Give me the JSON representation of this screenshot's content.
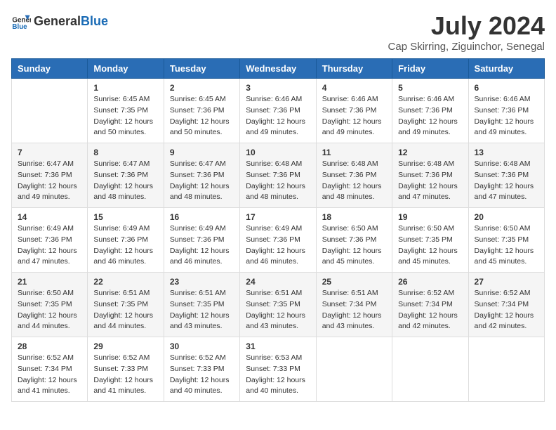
{
  "logo": {
    "text_general": "General",
    "text_blue": "Blue"
  },
  "title": "July 2024",
  "subtitle": "Cap Skirring, Ziguinchor, Senegal",
  "weekdays": [
    "Sunday",
    "Monday",
    "Tuesday",
    "Wednesday",
    "Thursday",
    "Friday",
    "Saturday"
  ],
  "weeks": [
    [
      {
        "day": "",
        "info": ""
      },
      {
        "day": "1",
        "info": "Sunrise: 6:45 AM\nSunset: 7:35 PM\nDaylight: 12 hours and 50 minutes."
      },
      {
        "day": "2",
        "info": "Sunrise: 6:45 AM\nSunset: 7:36 PM\nDaylight: 12 hours and 50 minutes."
      },
      {
        "day": "3",
        "info": "Sunrise: 6:46 AM\nSunset: 7:36 PM\nDaylight: 12 hours and 49 minutes."
      },
      {
        "day": "4",
        "info": "Sunrise: 6:46 AM\nSunset: 7:36 PM\nDaylight: 12 hours and 49 minutes."
      },
      {
        "day": "5",
        "info": "Sunrise: 6:46 AM\nSunset: 7:36 PM\nDaylight: 12 hours and 49 minutes."
      },
      {
        "day": "6",
        "info": "Sunrise: 6:46 AM\nSunset: 7:36 PM\nDaylight: 12 hours and 49 minutes."
      }
    ],
    [
      {
        "day": "7",
        "info": "Sunrise: 6:47 AM\nSunset: 7:36 PM\nDaylight: 12 hours and 49 minutes."
      },
      {
        "day": "8",
        "info": "Sunrise: 6:47 AM\nSunset: 7:36 PM\nDaylight: 12 hours and 48 minutes."
      },
      {
        "day": "9",
        "info": "Sunrise: 6:47 AM\nSunset: 7:36 PM\nDaylight: 12 hours and 48 minutes."
      },
      {
        "day": "10",
        "info": "Sunrise: 6:48 AM\nSunset: 7:36 PM\nDaylight: 12 hours and 48 minutes."
      },
      {
        "day": "11",
        "info": "Sunrise: 6:48 AM\nSunset: 7:36 PM\nDaylight: 12 hours and 48 minutes."
      },
      {
        "day": "12",
        "info": "Sunrise: 6:48 AM\nSunset: 7:36 PM\nDaylight: 12 hours and 47 minutes."
      },
      {
        "day": "13",
        "info": "Sunrise: 6:48 AM\nSunset: 7:36 PM\nDaylight: 12 hours and 47 minutes."
      }
    ],
    [
      {
        "day": "14",
        "info": "Sunrise: 6:49 AM\nSunset: 7:36 PM\nDaylight: 12 hours and 47 minutes."
      },
      {
        "day": "15",
        "info": "Sunrise: 6:49 AM\nSunset: 7:36 PM\nDaylight: 12 hours and 46 minutes."
      },
      {
        "day": "16",
        "info": "Sunrise: 6:49 AM\nSunset: 7:36 PM\nDaylight: 12 hours and 46 minutes."
      },
      {
        "day": "17",
        "info": "Sunrise: 6:49 AM\nSunset: 7:36 PM\nDaylight: 12 hours and 46 minutes."
      },
      {
        "day": "18",
        "info": "Sunrise: 6:50 AM\nSunset: 7:36 PM\nDaylight: 12 hours and 45 minutes."
      },
      {
        "day": "19",
        "info": "Sunrise: 6:50 AM\nSunset: 7:35 PM\nDaylight: 12 hours and 45 minutes."
      },
      {
        "day": "20",
        "info": "Sunrise: 6:50 AM\nSunset: 7:35 PM\nDaylight: 12 hours and 45 minutes."
      }
    ],
    [
      {
        "day": "21",
        "info": "Sunrise: 6:50 AM\nSunset: 7:35 PM\nDaylight: 12 hours and 44 minutes."
      },
      {
        "day": "22",
        "info": "Sunrise: 6:51 AM\nSunset: 7:35 PM\nDaylight: 12 hours and 44 minutes."
      },
      {
        "day": "23",
        "info": "Sunrise: 6:51 AM\nSunset: 7:35 PM\nDaylight: 12 hours and 43 minutes."
      },
      {
        "day": "24",
        "info": "Sunrise: 6:51 AM\nSunset: 7:35 PM\nDaylight: 12 hours and 43 minutes."
      },
      {
        "day": "25",
        "info": "Sunrise: 6:51 AM\nSunset: 7:34 PM\nDaylight: 12 hours and 43 minutes."
      },
      {
        "day": "26",
        "info": "Sunrise: 6:52 AM\nSunset: 7:34 PM\nDaylight: 12 hours and 42 minutes."
      },
      {
        "day": "27",
        "info": "Sunrise: 6:52 AM\nSunset: 7:34 PM\nDaylight: 12 hours and 42 minutes."
      }
    ],
    [
      {
        "day": "28",
        "info": "Sunrise: 6:52 AM\nSunset: 7:34 PM\nDaylight: 12 hours and 41 minutes."
      },
      {
        "day": "29",
        "info": "Sunrise: 6:52 AM\nSunset: 7:33 PM\nDaylight: 12 hours and 41 minutes."
      },
      {
        "day": "30",
        "info": "Sunrise: 6:52 AM\nSunset: 7:33 PM\nDaylight: 12 hours and 40 minutes."
      },
      {
        "day": "31",
        "info": "Sunrise: 6:53 AM\nSunset: 7:33 PM\nDaylight: 12 hours and 40 minutes."
      },
      {
        "day": "",
        "info": ""
      },
      {
        "day": "",
        "info": ""
      },
      {
        "day": "",
        "info": ""
      }
    ]
  ]
}
